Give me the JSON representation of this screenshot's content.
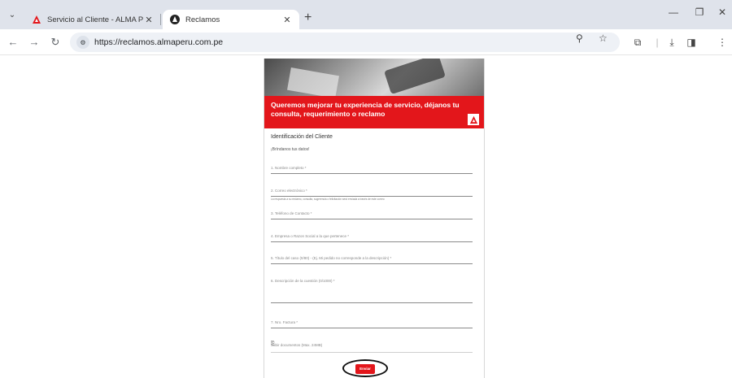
{
  "browser": {
    "tabs": [
      {
        "title": "Servicio al Cliente - ALMA Perú",
        "active": false,
        "favicon": "alma-logo-icon"
      },
      {
        "title": "Reclamos",
        "active": true,
        "favicon": "angular-icon"
      }
    ],
    "url": "https://reclamos.almaperu.com.pe",
    "accent": "#e3161b"
  },
  "form": {
    "banner_text": "Queremos mejorar tu experiencia de servicio, déjanos tu consulta, requerimiento o reclamo",
    "section_title": "Identificación del Cliente",
    "section_subtitle": "¡Bríndanos tus datos!",
    "fields": [
      {
        "label": "1. Nombre completo *"
      },
      {
        "label": "2. Correo electrónico *",
        "hint": "La respuesta a su reclamo, consulta, sugerencia o felicitación será enviada a través de este correo"
      },
      {
        "label": "3. Teléfono de Contacto *"
      },
      {
        "label": "4. Empresa o Razon Social a la que pertenece *"
      },
      {
        "label": "5. Título del caso (0/80) - (Ej. Mi pedido no corresponde a la descripción) *"
      },
      {
        "label": "6. Descripción de la cuestión (0/1000) *"
      },
      {
        "label": "7. Nro. Factura *"
      }
    ],
    "upload_label": "Subir documentos (Max. 24MB)",
    "submit_label": "Enviar"
  }
}
